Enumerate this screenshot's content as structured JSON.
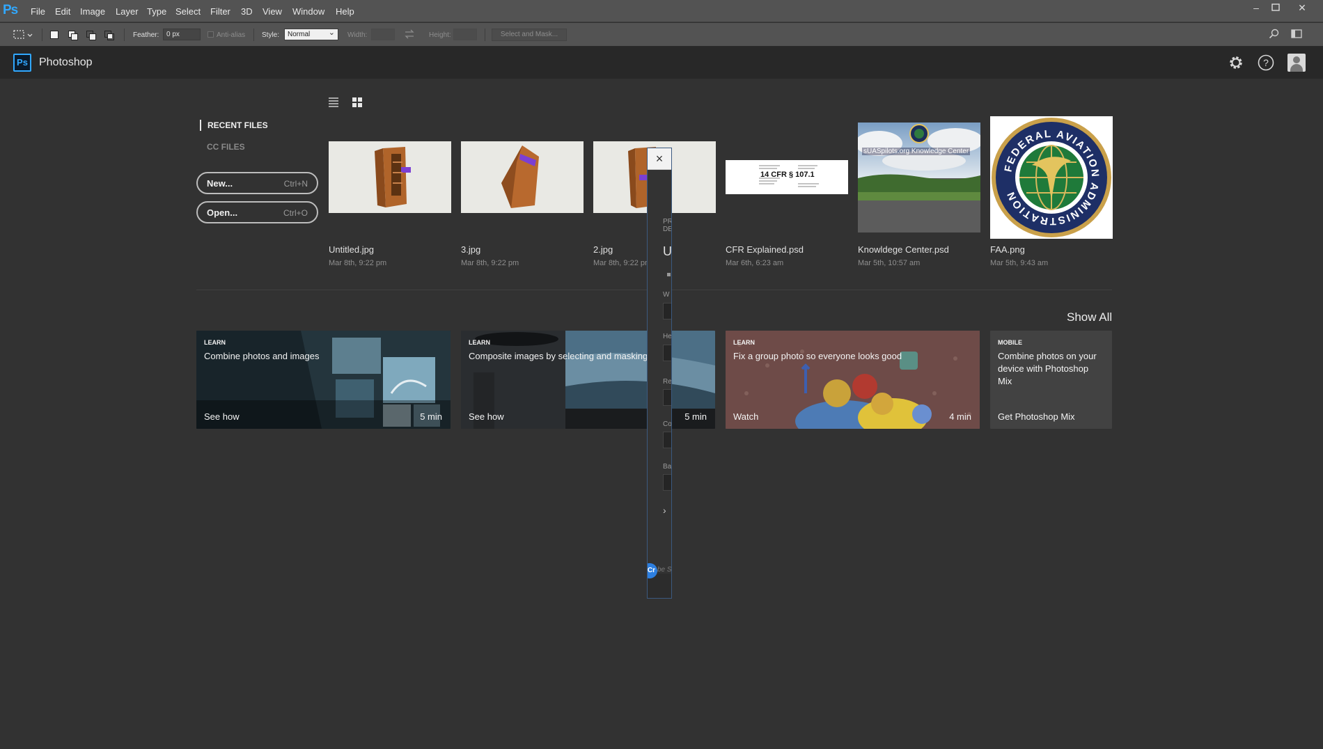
{
  "app": {
    "logo": "Ps",
    "title": "Photoshop",
    "badge": "Ps"
  },
  "menu": [
    "File",
    "Edit",
    "Image",
    "Layer",
    "Type",
    "Select",
    "Filter",
    "3D",
    "View",
    "Window",
    "Help"
  ],
  "options_bar": {
    "feather_label": "Feather:",
    "feather_value": "0 px",
    "antialias_label": "Anti-alias",
    "style_label": "Style:",
    "style_value": "Normal",
    "width_label": "Width:",
    "height_label": "Height:",
    "select_mask_label": "Select and Mask..."
  },
  "nav": {
    "recent_files": "RECENT FILES",
    "cc_files": "CC FILES",
    "new_label": "New...",
    "new_shortcut": "Ctrl+N",
    "open_label": "Open...",
    "open_shortcut": "Ctrl+O"
  },
  "recent_files": [
    {
      "name": "Untitled.jpg",
      "date": "Mar 8th, 9:22 pm"
    },
    {
      "name": "3.jpg",
      "date": "Mar 8th, 9:22 pm"
    },
    {
      "name": "2.jpg",
      "date": "Mar 8th, 9:22 pm"
    },
    {
      "name": "CFR Explained.psd",
      "date": "Mar 6th, 6:23 am",
      "thumb_text": "14 CFR § 107.1"
    },
    {
      "name": "Knowldege Center.psd",
      "date": "Mar 5th, 10:57 am",
      "thumb_text": "sUASpilots.org Knowledge Center"
    },
    {
      "name": "FAA.png",
      "date": "Mar 5th, 9:43 am",
      "seal_text": "FEDERAL AVIATION ADMINISTRATION"
    }
  ],
  "show_all": "Show All",
  "learn_cards": [
    {
      "tag": "LEARN",
      "title": "Combine photos and images",
      "action": "See how",
      "duration": "5 min"
    },
    {
      "tag": "LEARN",
      "title": "Composite images by selecting and masking",
      "action": "See how",
      "duration": "5 min"
    },
    {
      "tag": "LEARN",
      "title": "Fix a group photo so everyone looks good",
      "action": "Watch",
      "duration": "4 min"
    },
    {
      "tag": "MOBILE",
      "title": "Combine photos on your device with Photoshop Mix",
      "action": "Get Photoshop Mix",
      "duration": ""
    }
  ],
  "dialog": {
    "close_icon": "×",
    "fragments": [
      "PR",
      "DE",
      "U",
      "W",
      "He",
      "Re",
      "Co",
      "Ba"
    ],
    "chevron": "›",
    "avatar_text": "Cr",
    "search_placeholder_fragment": "be S"
  },
  "colors": {
    "accent": "#31a8ff",
    "background": "#323232",
    "chrome": "#535353"
  }
}
